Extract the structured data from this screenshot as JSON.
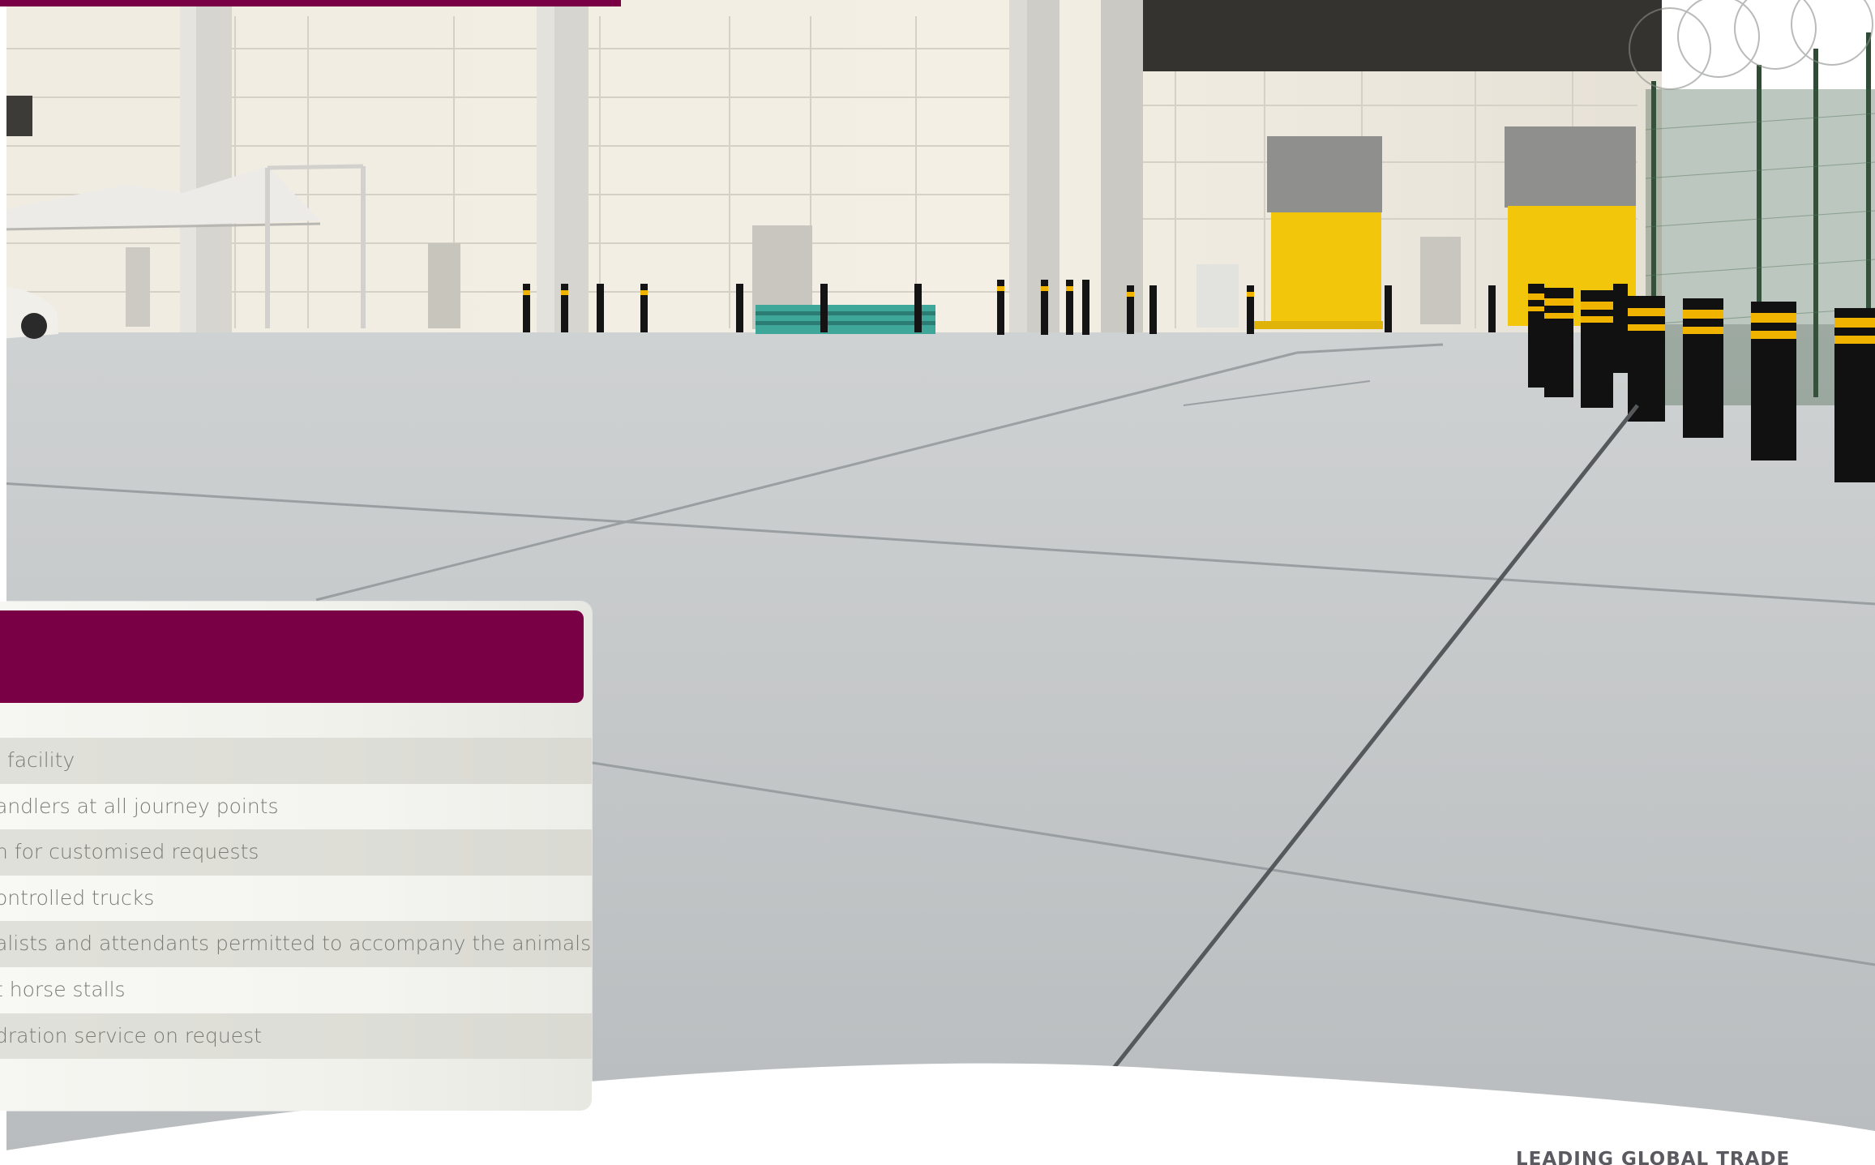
{
  "feature_list": {
    "items": [
      "l facility",
      "andlers at all journey points",
      "n for customised requests",
      "ontrolled trucks",
      "alists and attendants permitted to accompany the animals",
      "t horse stalls",
      "dration service on request"
    ]
  },
  "footer": {
    "tagline": "LEADING GLOBAL TRADE"
  },
  "colors": {
    "brand": "#7a0045",
    "dock_door": "#f2c60a",
    "bollard_stripe": "#f0b400"
  }
}
